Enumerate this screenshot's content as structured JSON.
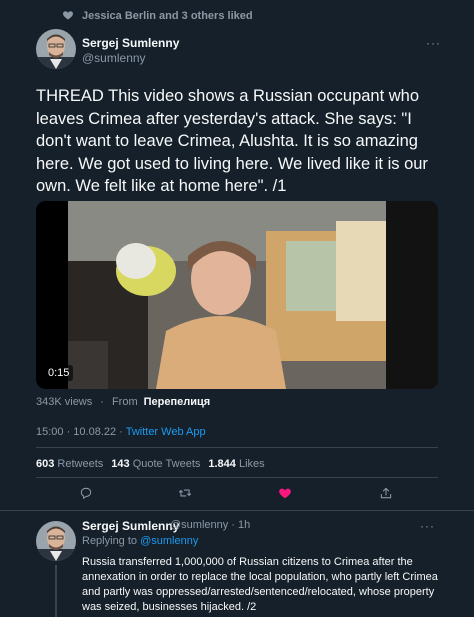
{
  "liked_by": "Jessica Berlin and 3 others liked",
  "tweet": {
    "author_name": "Sergej Sumlenny",
    "author_handle": "@sumlenny",
    "more": "···",
    "text": "THREAD This video shows a Russian occupant who leaves Crimea after yesterday's attack. She says: \"I don't want to leave Crimea, Alushta. It is so amazing here. We got used to living here. We lived like it is our own. We felt like at home here\". /1",
    "video_time": "0:15",
    "views": "343K views",
    "from_label": "From",
    "from_source": "Перепелиця",
    "timestamp": "15:00 · 10.08.22 · ",
    "client": "Twitter Web App",
    "retweets_count": "603",
    "retweets_label": "Retweets",
    "quotes_count": "143",
    "quotes_label": "Quote Tweets",
    "likes_count": "1.844",
    "likes_label": "Likes"
  },
  "icons": {
    "liked": "heart-icon",
    "reply": "comment-icon",
    "retweet": "retweet-icon",
    "like": "heart-filled-icon",
    "share": "share-icon",
    "gif": "video-settings-icon",
    "mute": "speaker-icon"
  },
  "colors": {
    "background": "#15202b",
    "accent": "#1d9bf0",
    "like": "#f91880",
    "muted": "#8b98a5"
  },
  "reply_tweet": {
    "author_name": "Sergej Sumlenny",
    "author_handle": "@sumlenny · 1h",
    "replying_prefix": "Replying to ",
    "replying_to": "@sumlenny",
    "text": "Russia transferred 1,000,000 of Russian citizens to Crimea after the annexation in order to replace the local population, who partly left Crimea and partly was oppressed/arrested/sentenced/relocated, whose property was seized, businesses hijacked. /2",
    "more": "···"
  }
}
